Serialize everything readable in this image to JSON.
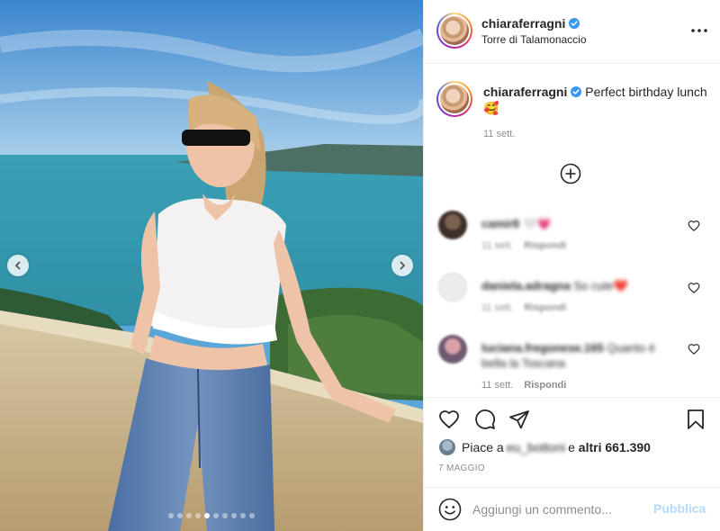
{
  "post": {
    "username": "chiaraferragni",
    "location": "Torre di Talamonaccio",
    "caption_text": "Perfect birthday lunch",
    "caption_emoji": "🥰",
    "caption_time": "11 sett.",
    "carousel": {
      "total_slides": 10,
      "active_slide": 5
    }
  },
  "comments": [
    {
      "username": "camir8",
      "text": "🤍💗",
      "time": "11 sett.",
      "reply_label": "Rispondi"
    },
    {
      "username": "daniela.adragna",
      "text": "So cute❤️",
      "time": "11 sett.",
      "reply_label": "Rispondi"
    },
    {
      "username": "luciana.fregonese.165",
      "text": "Quanto è bella la Toscana",
      "time": "11 sett.",
      "reply_label": "Rispondi"
    }
  ],
  "likes": {
    "prefix": "Piace a",
    "user": "eu_bottoni",
    "connector": "e",
    "others": "altri 661.390"
  },
  "date": "7 MAGGIO",
  "add_comment": {
    "placeholder": "Aggiungi un commento...",
    "post_label": "Pubblica"
  },
  "icons": {
    "verified": "verified-badge-icon",
    "more": "more-options-icon",
    "plus": "load-more-comments-icon",
    "like": "heart-icon",
    "comment": "comment-bubble-icon",
    "share": "paper-plane-icon",
    "save": "bookmark-icon",
    "emoji": "emoji-smile-icon"
  },
  "colors": {
    "verified_blue": "#3897f0",
    "text_primary": "#262626",
    "text_secondary": "#8e8e8e",
    "post_button_disabled": "#b3dbff",
    "divider": "#efefef"
  }
}
